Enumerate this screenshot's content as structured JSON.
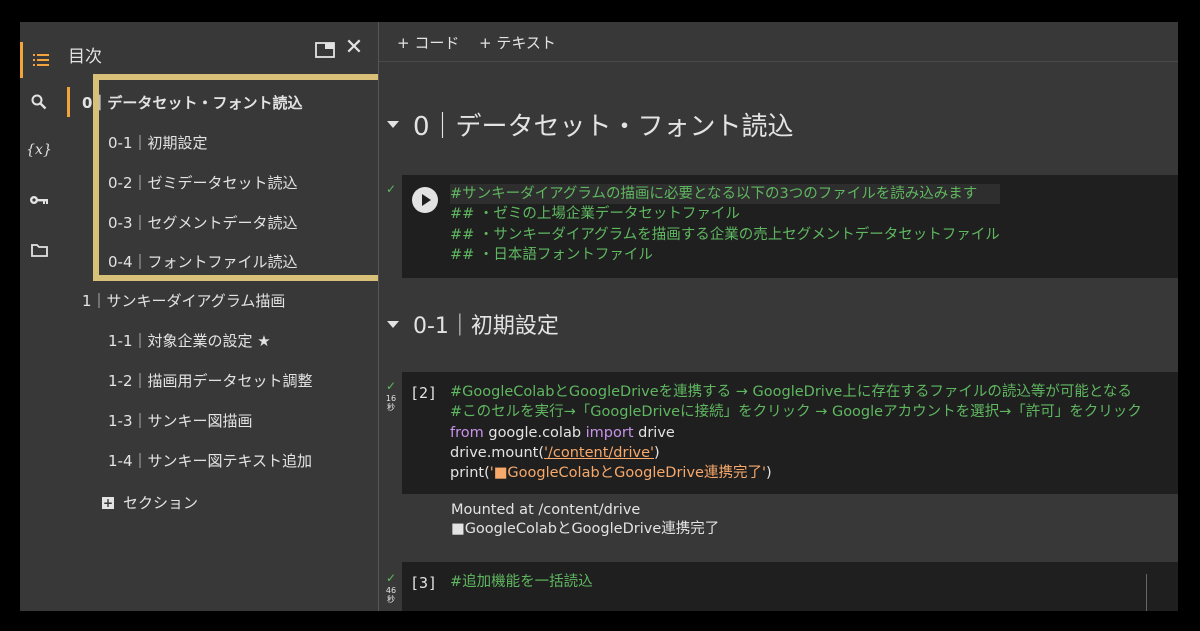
{
  "toc": {
    "title": "目次",
    "items": [
      {
        "label": "0｜データセット・フォント読込",
        "active": true
      },
      {
        "label": "0-1｜初期設定"
      },
      {
        "label": "0-2｜ゼミデータセット読込"
      },
      {
        "label": "0-3｜セグメントデータ読込"
      },
      {
        "label": "0-4｜フォントファイル読込"
      },
      {
        "label": "1｜サンキーダイアグラム描画"
      },
      {
        "label": "1-1｜対象企業の設定 ★"
      },
      {
        "label": "1-2｜描画用データセット調整"
      },
      {
        "label": "1-3｜サンキー図描画"
      },
      {
        "label": "1-4｜サンキー図テキスト追加"
      }
    ],
    "add_section": "セクション"
  },
  "toolbar": {
    "code_label": "+ コード",
    "text_label": "+ テキスト"
  },
  "headings": {
    "h0": "0｜データセット・フォント読込",
    "h01": "0-1｜初期設定"
  },
  "cells": {
    "cell1": {
      "lines": [
        "#サンキーダイアグラムの描画に必要となる以下の3つのファイルを読み込みます",
        "## ・ゼミの上場企業データセットファイル",
        "## ・サンキーダイアグラムを描画する企業の売上セグメントデータセットファイル",
        "## ・日本語フォントファイル"
      ]
    },
    "cell2": {
      "count": "[2]",
      "time": "16\n秒",
      "comment1": "#GoogleColabとGoogleDriveを連携する → GoogleDrive上に存在するファイルの読込等が可能となる",
      "comment2": "#このセルを実行→「GoogleDriveに接続」をクリック → Googleアカウントを選択→「許可」をクリック",
      "kw_from": "from",
      "module": "google.colab",
      "kw_import": "import",
      "name": "drive",
      "mount_call": "drive.mount(",
      "mount_arg": "'/content/drive'",
      "mount_close": ")",
      "print_call": "print(",
      "print_arg": "'■GoogleColabとGoogleDrive連携完了'",
      "print_close": ")",
      "output": [
        "Mounted at /content/drive",
        "■GoogleColabとGoogleDrive連携完了"
      ]
    },
    "cell3": {
      "count": "[3]",
      "time": "46\n秒",
      "comment": "#追加機能を一括読込"
    }
  },
  "status_check": "✓",
  "colors": {
    "accent": "#f2a33a",
    "highlight_border": "#d8c078",
    "comment_green": "#5fb760",
    "keyword_purple": "#c792ea",
    "string_orange": "#f7a86b"
  }
}
